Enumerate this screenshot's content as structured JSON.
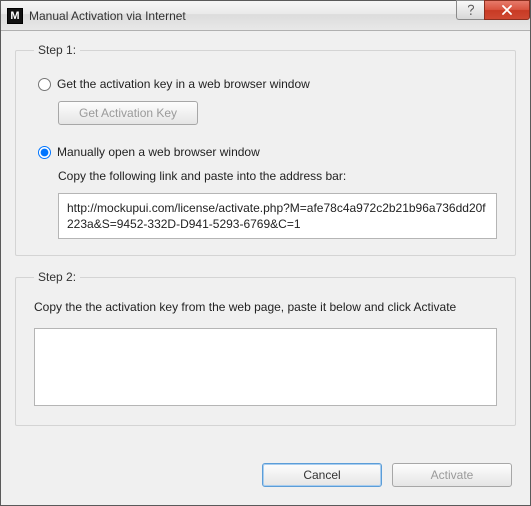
{
  "window": {
    "title": "Manual Activation via Internet",
    "app_icon_letter": "M"
  },
  "step1": {
    "legend": "Step 1:",
    "option_browser_label": "Get the activation key in a web browser window",
    "get_key_button": "Get Activation Key",
    "option_manual_label": "Manually open a web browser window",
    "copy_instruction": "Copy the following link and paste into the address bar:",
    "url": "http://mockupui.com/license/activate.php?M=afe78c4a972c2b21b96a736dd20f223a&S=9452-332D-D941-5293-6769&C=1"
  },
  "step2": {
    "legend": "Step 2:",
    "instruction": "Copy the the activation key from the web page, paste it below and click Activate",
    "key_value": ""
  },
  "footer": {
    "cancel": "Cancel",
    "activate": "Activate"
  }
}
